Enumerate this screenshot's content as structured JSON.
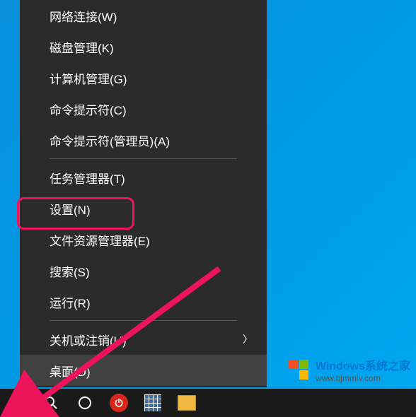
{
  "menu": {
    "items": [
      {
        "label": "网络连接(W)",
        "has_submenu": false
      },
      {
        "label": "磁盘管理(K)",
        "has_submenu": false
      },
      {
        "label": "计算机管理(G)",
        "has_submenu": false
      },
      {
        "label": "命令提示符(C)",
        "has_submenu": false
      },
      {
        "label": "命令提示符(管理员)(A)",
        "has_submenu": false
      },
      {
        "separator": true
      },
      {
        "label": "任务管理器(T)",
        "has_submenu": false
      },
      {
        "label": "设置(N)",
        "has_submenu": false,
        "highlighted": true
      },
      {
        "label": "文件资源管理器(E)",
        "has_submenu": false
      },
      {
        "label": "搜索(S)",
        "has_submenu": false
      },
      {
        "label": "运行(R)",
        "has_submenu": false
      },
      {
        "separator": true
      },
      {
        "label": "关机或注销(U)",
        "has_submenu": true
      },
      {
        "label": "桌面(D)",
        "has_submenu": false,
        "hovered": true
      }
    ]
  },
  "watermark": {
    "line1": "Windows系统之家",
    "line2": "www.bjmmlv.com"
  },
  "annotation": {
    "highlight_color": "#ed145b",
    "arrow_color": "#ed145b"
  },
  "colors": {
    "desktop_bg": "#0099e5",
    "menu_bg": "#2b2b2b",
    "menu_text": "#ffffff",
    "menu_hover": "#414141",
    "taskbar_bg": "#1a1a1a"
  }
}
